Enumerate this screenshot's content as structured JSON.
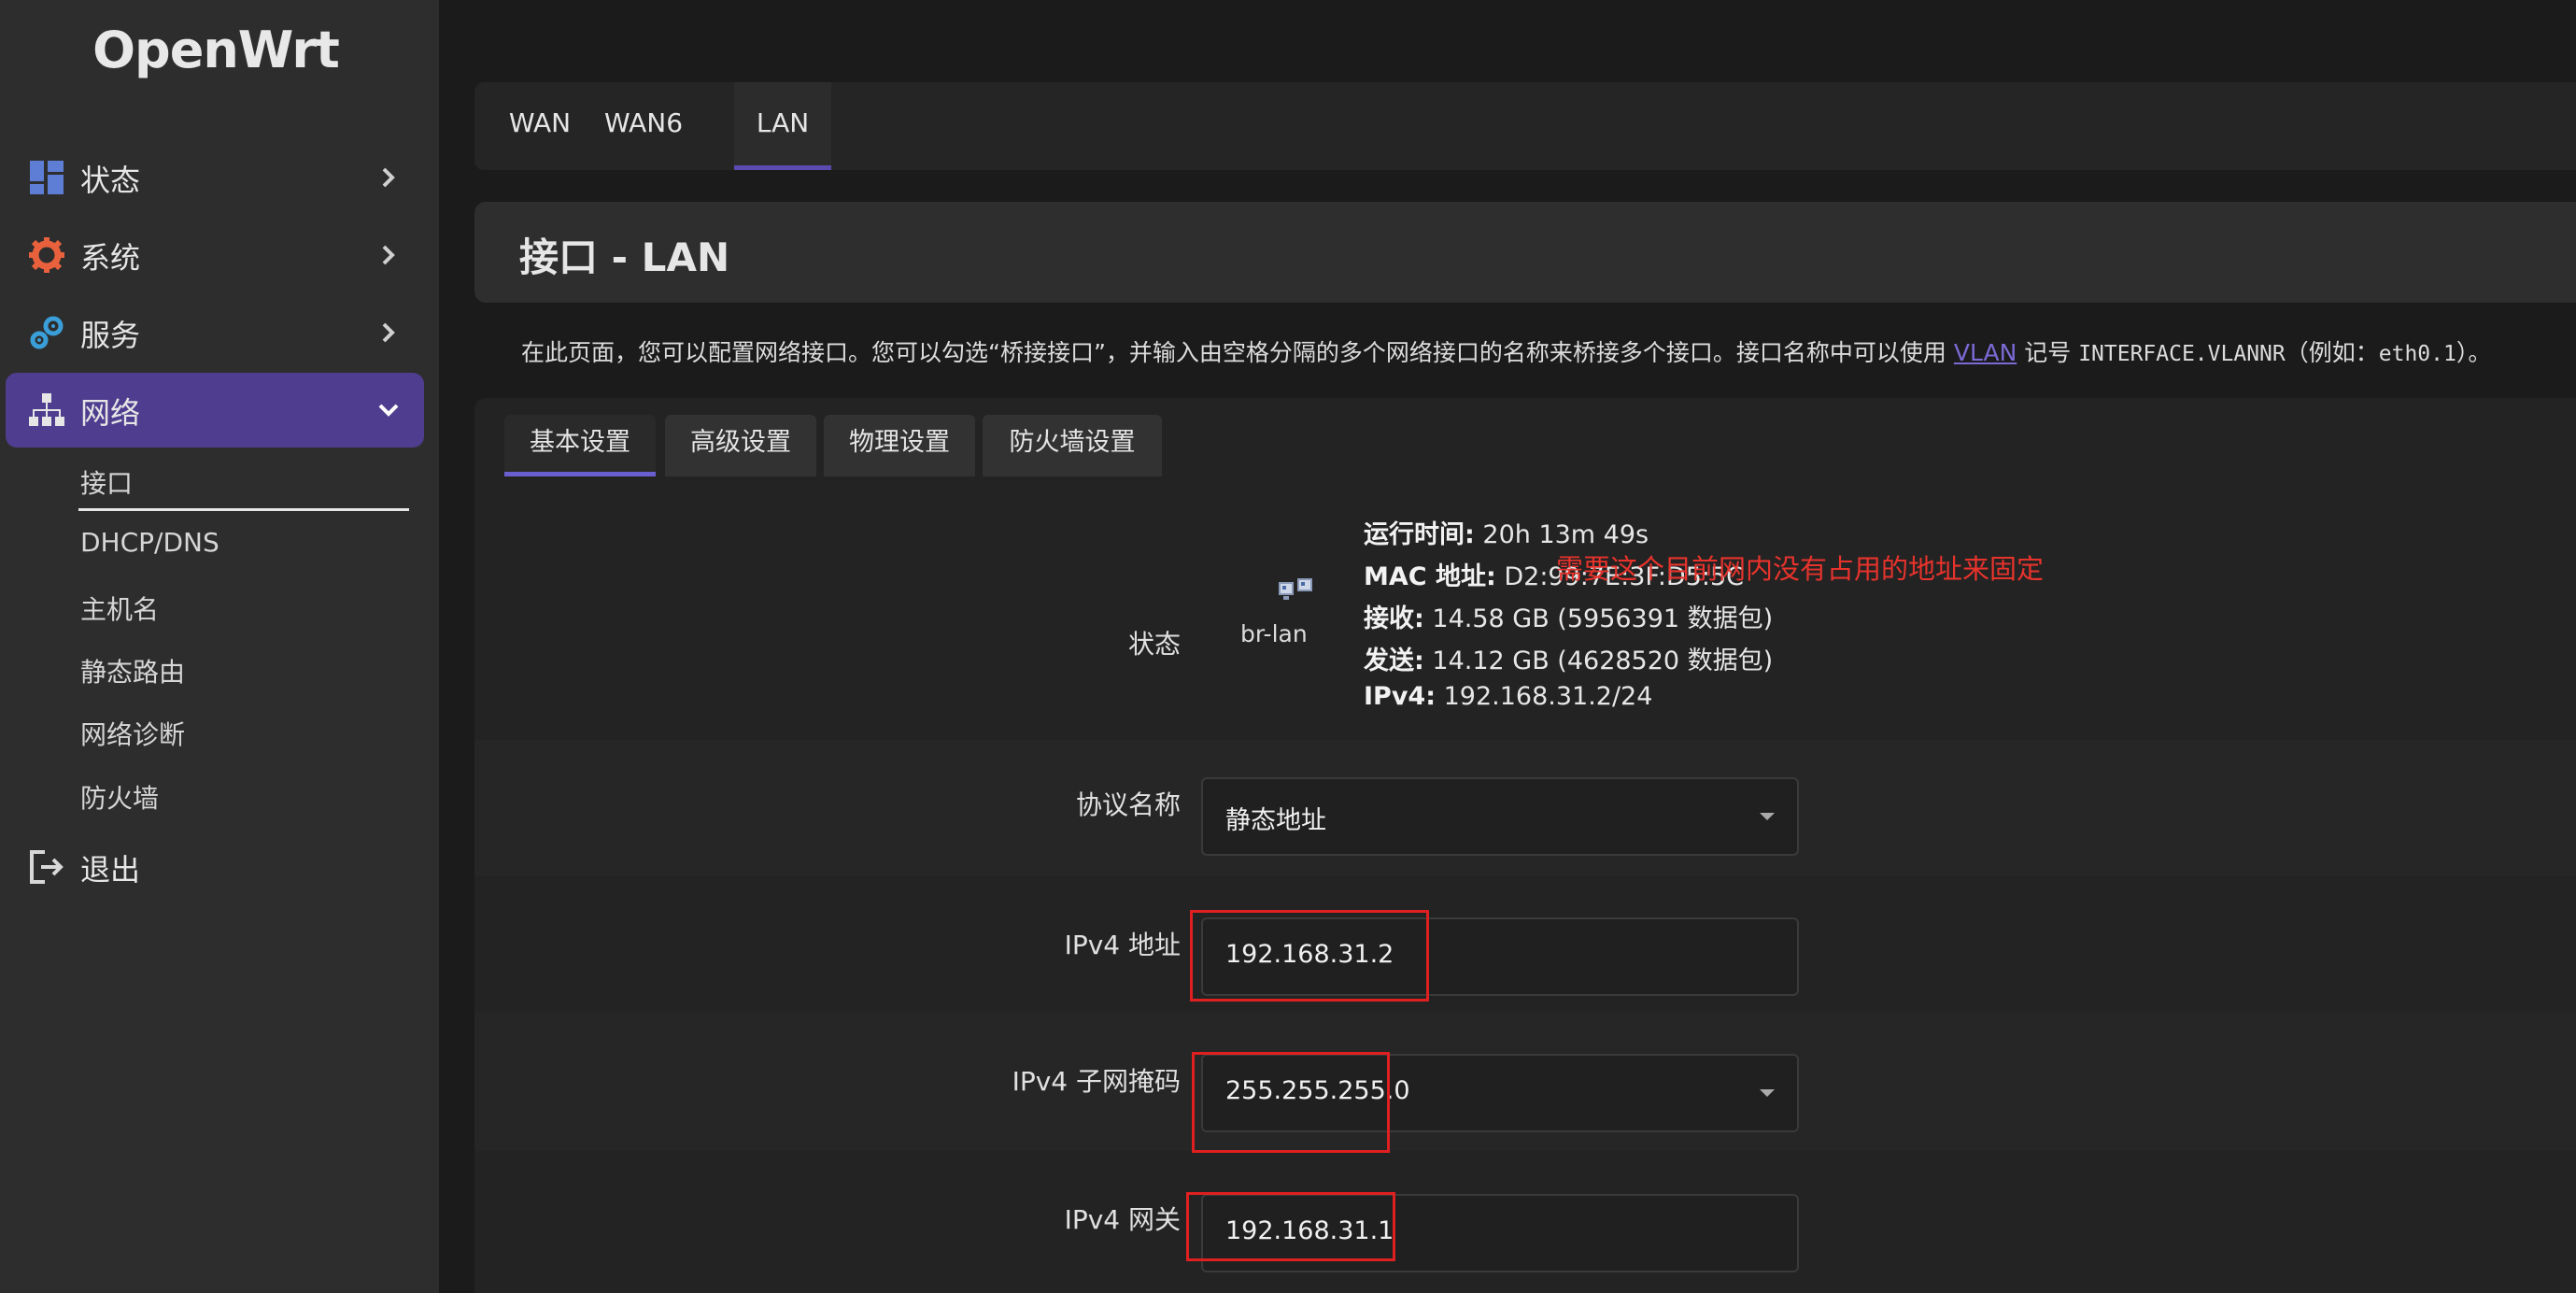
{
  "logo": "OpenWrt",
  "sidebar": {
    "items": [
      {
        "label": "状态",
        "icon": "dashboard-icon"
      },
      {
        "label": "系统",
        "icon": "gear-icon"
      },
      {
        "label": "服务",
        "icon": "services-gears-icon"
      },
      {
        "label": "网络",
        "icon": "network-tree-icon"
      },
      {
        "label": "退出",
        "icon": "logout-icon"
      }
    ],
    "sub_items": [
      "接口",
      "DHCP/DNS",
      "主机名",
      "静态路由",
      "网络诊断",
      "防火墙"
    ]
  },
  "top_tabs": [
    "WAN",
    "WAN6",
    "LAN"
  ],
  "page": {
    "title": "接口 - LAN",
    "desc_before_link": "在此页面，您可以配置网络接口。您可以勾选“桥接接口”，并输入由空格分隔的多个网络接口的名称来桥接多个接口。接口名称中可以使用 ",
    "desc_link": "VLAN",
    "desc_mid": " 记号 ",
    "desc_code1": "INTERFACE.VLANNR",
    "desc_paren": "（例如：",
    "desc_code2": "eth0.1",
    "desc_end": "）。"
  },
  "sub_tabs": [
    "基本设置",
    "高级设置",
    "物理设置",
    "防火墙设置"
  ],
  "status": {
    "label": "状态",
    "device": "br-lan",
    "uptime_key": "运行时间:",
    "uptime_val": " 20h 13m 49s",
    "mac_key": "MAC 地址:",
    "mac_val": " D2:99:7E:3F:D5:5C",
    "rx_key": "接收:",
    "rx_val": " 14.58 GB (5956391 数据包)",
    "tx_key": "发送:",
    "tx_val": " 14.12 GB (4628520 数据包)",
    "ipv4_key": "IPv4:",
    "ipv4_val": " 192.168.31.2/24"
  },
  "form": {
    "protocol_label": "协议名称",
    "protocol_value": "静态地址",
    "ipv4_addr_label": "IPv4 地址",
    "ipv4_addr_value": "192.168.31.2",
    "netmask_label": "IPv4 子网掩码",
    "netmask_value": "255.255.255.0",
    "gateway_label": "IPv4 网关",
    "gateway_value": "192.168.31.1"
  },
  "annotation": "需要这个目前网内没有占用的地址来固定",
  "colors": {
    "sidebar_bg": "#2d2d2d",
    "active_nav": "#4f3e8f",
    "accent": "#5b4bb0",
    "annotation_red": "#e02020"
  }
}
